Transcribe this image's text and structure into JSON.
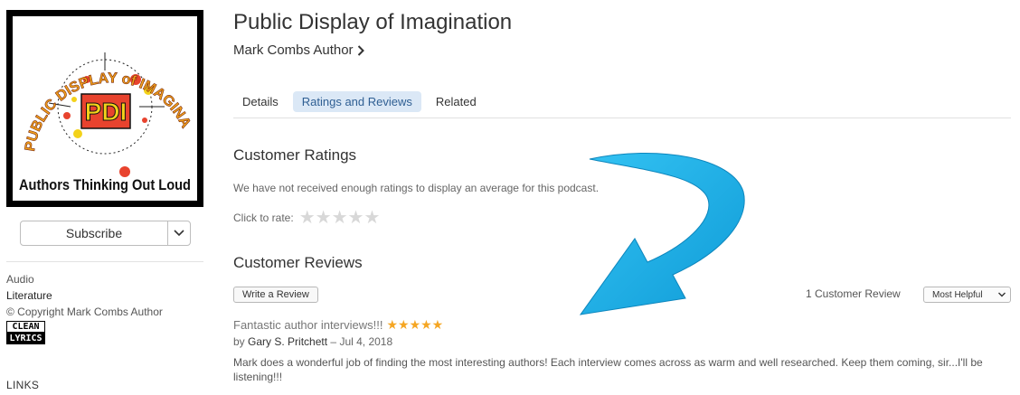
{
  "sidebar": {
    "artwork": {
      "arc_text": "PUBLIC DISPLAY of IMAGINATION",
      "logo_text": "PDI",
      "banner_text": "Authors Thinking Out Loud"
    },
    "subscribe_label": "Subscribe",
    "kind": "Audio",
    "genre": "Literature",
    "copyright": "© Copyright Mark Combs Author",
    "clean_badge": {
      "top": "CLEAN",
      "bottom": "LYRICS"
    },
    "links_heading": "LINKS"
  },
  "header": {
    "title": "Public Display of Imagination",
    "artist": "Mark Combs Author"
  },
  "tabs": [
    {
      "label": "Details",
      "active": false
    },
    {
      "label": "Ratings and Reviews",
      "active": true
    },
    {
      "label": "Related",
      "active": false
    }
  ],
  "ratings": {
    "heading": "Customer Ratings",
    "message": "We have not received enough ratings to display an average for this podcast.",
    "click_to_rate": "Click to rate:",
    "star_count": 5
  },
  "reviews": {
    "heading": "Customer Reviews",
    "write_label": "Write a Review",
    "count_label": "1 Customer Review",
    "sort_value": "Most Helpful",
    "items": [
      {
        "title": "Fantastic author interviews!!!",
        "rating": 5,
        "by_prefix": "by",
        "author": "Gary S. Pritchett",
        "date_sep": "–",
        "date": "Jul 4, 2018",
        "body": "Mark does a wonderful job of finding the most interesting authors! Each interview comes across as warm and well researched. Keep them coming, sir...I'll be listening!!!"
      }
    ]
  },
  "colors": {
    "accent_tab_bg": "#dbe8f6",
    "accent_tab_text": "#2f5f93",
    "review_star": "#f5a623",
    "overlay_arrow": "#17a9e3"
  },
  "icons": [
    "chevron-right-icon",
    "chevron-down-icon",
    "star-icon",
    "big-curved-arrow"
  ]
}
